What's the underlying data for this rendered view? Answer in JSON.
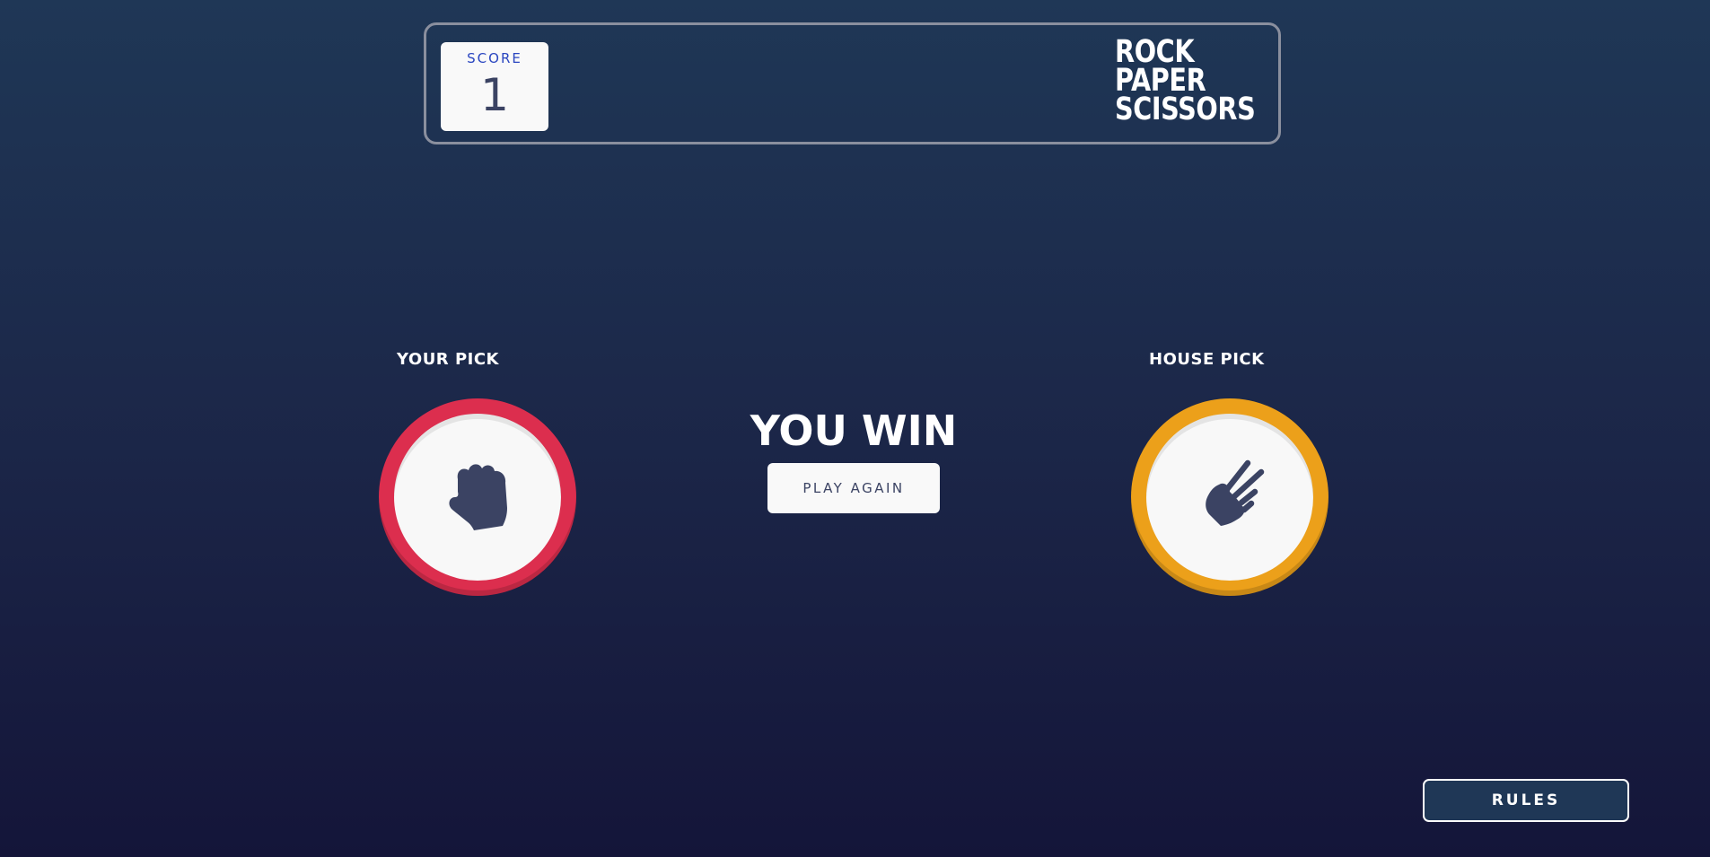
{
  "header": {
    "score_label": "SCORE",
    "score_value": "1",
    "logo_lines": [
      "ROCK",
      "PAPER",
      "SCISSORS"
    ]
  },
  "game": {
    "your_pick_label": "YOUR PICK",
    "house_pick_label": "HOUSE PICK",
    "your_pick": {
      "choice": "rock",
      "icon": "rock-fist-icon",
      "ring_color": "#dc2e4e"
    },
    "house_pick": {
      "choice": "scissors",
      "icon": "scissors-hand-icon",
      "ring_color": "#eca01a"
    },
    "result_text": "YOU WIN",
    "play_again_label": "PLAY AGAIN"
  },
  "footer": {
    "rules_label": "RULES"
  },
  "colors": {
    "background_top": "#1f3756",
    "background_bottom": "#141539",
    "score_label": "#2a46c0",
    "dark_text": "#3b4363"
  }
}
